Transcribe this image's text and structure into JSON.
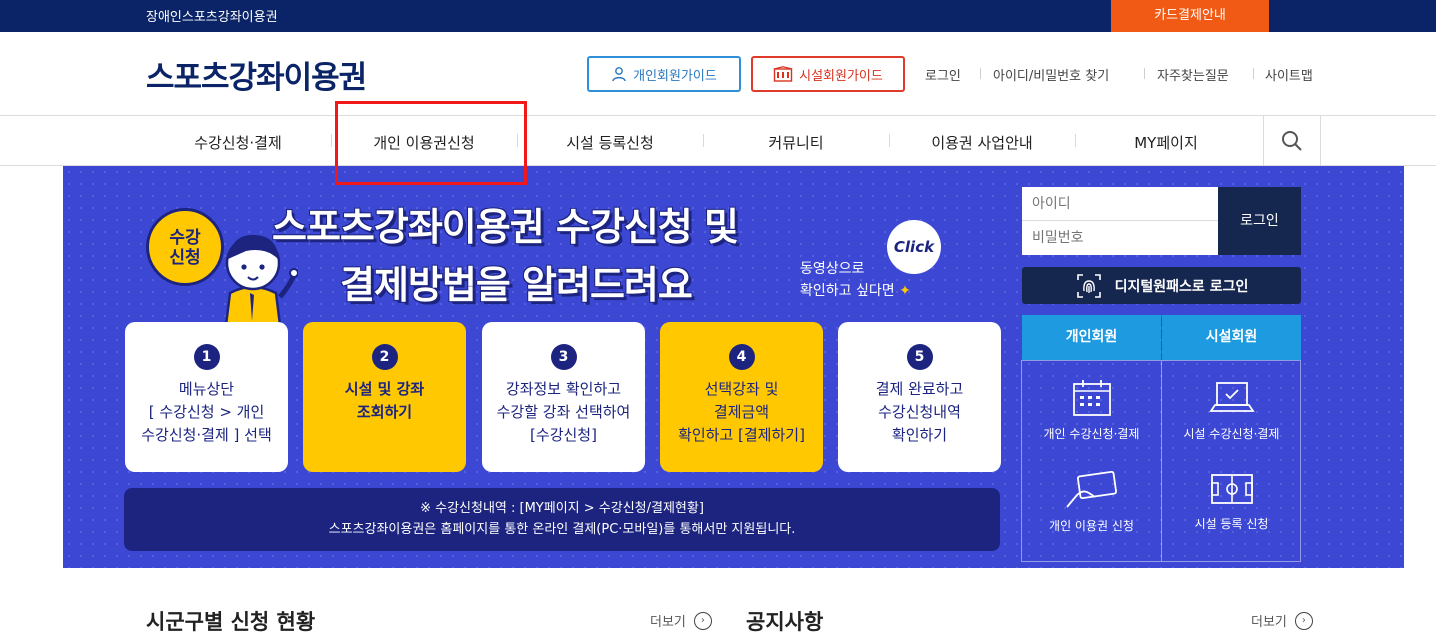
{
  "topbar": {
    "site_name": "장애인스포츠강좌이용권",
    "card_payment": "카드결제안내"
  },
  "header": {
    "logo": "스포츠강좌이용권",
    "guide_personal": "개인회원가이드",
    "guide_facility": "시설회원가이드",
    "util": [
      "로그인",
      "아이디/비밀번호 찾기",
      "자주찾는질문",
      "사이트맵"
    ]
  },
  "gnb": {
    "items": [
      "수강신청·결제",
      "개인 이용권신청",
      "시설 등록신청",
      "커뮤니티",
      "이용권 사업안내",
      "MY페이지"
    ]
  },
  "banner": {
    "badge": "수강\n신청",
    "headline_line1": "스포츠강좌이용권 수강신청 및",
    "headline_line2": "결제방법을 알려드려요",
    "click": "Click",
    "video_note": "동영상으로\n확인하고 싶다면",
    "steps": [
      {
        "num": "1",
        "text": "메뉴상단\n[ 수강신청 > 개인\n수강신청·결제 ] 선택"
      },
      {
        "num": "2",
        "text": "시설 및 강좌\n조회하기"
      },
      {
        "num": "3",
        "text": "강좌정보 확인하고\n수강할 강좌 선택하여\n[수강신청]"
      },
      {
        "num": "4",
        "text": "선택강좌 및\n결제금액\n확인하고 [결제하기]"
      },
      {
        "num": "5",
        "text": "결제 완료하고\n수강신청내역\n확인하기"
      }
    ],
    "notice_line1": "※ 수강신청내역 : [MY페이지 > 수강신청/결제현황]",
    "notice_line2": "스포츠강좌이용권은 홈페이지를 통한 온라인 결제(PC·모바일)를 통해서만 지원됩니다."
  },
  "login_panel": {
    "id_placeholder": "아이디",
    "pw_placeholder": "비밀번호",
    "login_button": "로그인",
    "digital_login": "디지털원패스로 로그인",
    "tab_personal": "개인회원",
    "tab_facility": "시설회원",
    "quick_links": [
      "개인 수강신청·결제",
      "시설 수강신청·결제",
      "개인 이용권 신청",
      "시설 등록 신청"
    ]
  },
  "sections": {
    "status_title": "시군구별 신청 현황",
    "notice_title": "공지사항",
    "more": "더보기"
  },
  "colors": {
    "navy": "#0b2467",
    "banner_blue": "#3c48d4",
    "accent_orange": "#f05a14",
    "yellow": "#ffc800",
    "tab_blue": "#1e9be0"
  }
}
